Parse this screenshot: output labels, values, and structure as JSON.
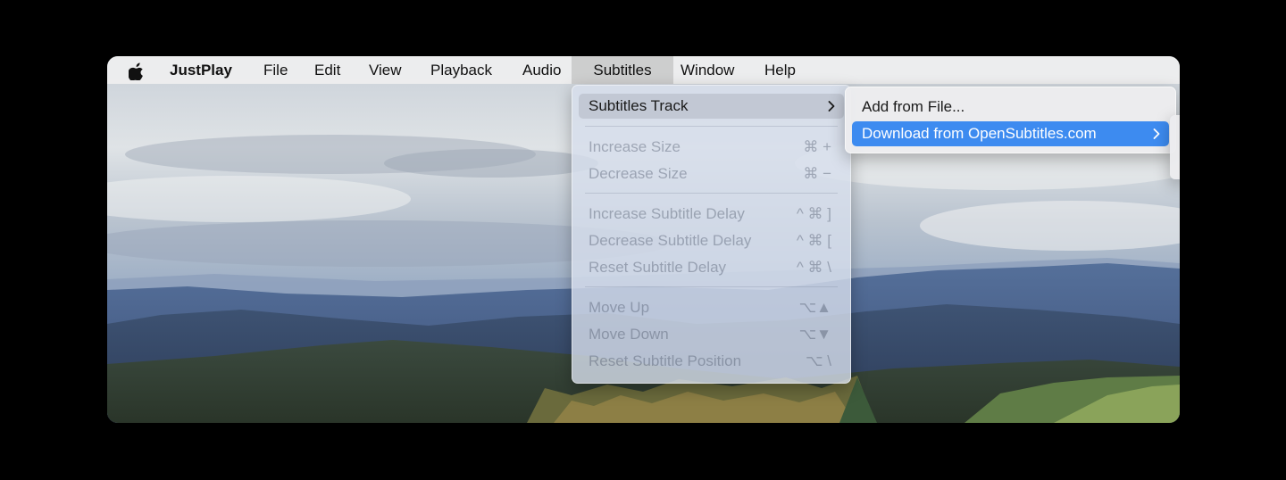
{
  "app_name": "JustPlay",
  "menubar": {
    "apple_icon": "apple-logo-icon",
    "items": [
      "File",
      "Edit",
      "View",
      "Playback",
      "Audio",
      "Subtitles",
      "Window",
      "Help"
    ],
    "active": "Subtitles"
  },
  "subtitles_menu": {
    "track": {
      "label": "Subtitles Track",
      "icon": "chevron-right-icon"
    },
    "increase_size": {
      "label": "Increase Size",
      "shortcut": "⌘ +"
    },
    "decrease_size": {
      "label": "Decrease Size",
      "shortcut": "⌘ −"
    },
    "increase_delay": {
      "label": "Increase Subtitle Delay",
      "shortcut": "^ ⌘ ]"
    },
    "decrease_delay": {
      "label": "Decrease Subtitle Delay",
      "shortcut": "^ ⌘ ["
    },
    "reset_delay": {
      "label": "Reset Subtitle Delay",
      "shortcut": "^ ⌘ \\"
    },
    "move_up": {
      "label": "Move Up",
      "shortcut": "⌥▲"
    },
    "move_down": {
      "label": "Move Down",
      "shortcut": "⌥▼"
    },
    "reset_position": {
      "label": "Reset Subtitle Position",
      "shortcut": "⌥ \\"
    }
  },
  "track_submenu": {
    "add_from_file": "Add from File...",
    "download": {
      "label": "Download from OpenSubtitles.com",
      "icon": "chevron-right-icon"
    }
  },
  "colors": {
    "selection": "#3d8bf0",
    "menubar": "#f0f0f0",
    "background": "#000000"
  }
}
